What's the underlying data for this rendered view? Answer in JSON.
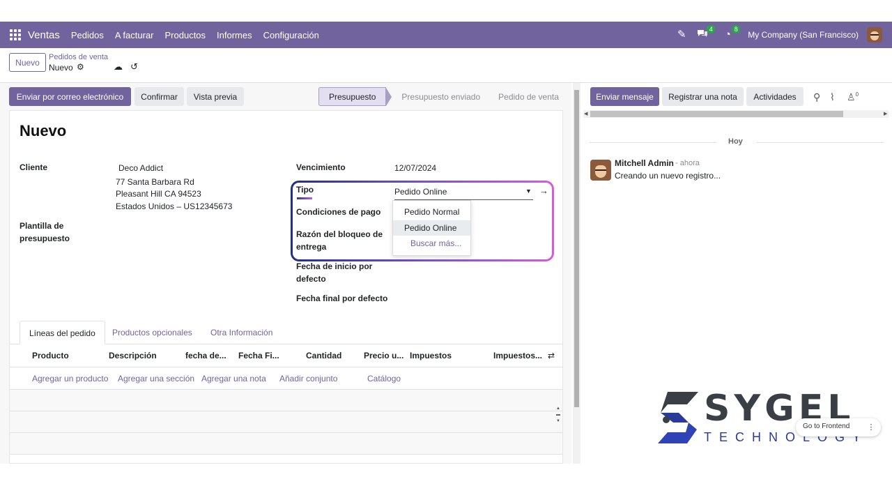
{
  "nav": {
    "app": "Ventas",
    "menu": [
      "Pedidos",
      "A facturar",
      "Productos",
      "Informes",
      "Configuración"
    ],
    "messages_count": "4",
    "activities_count": "8",
    "company": "My Company (San Francisco)"
  },
  "control": {
    "new_label": "Nuevo",
    "breadcrumb": "Pedidos de venta",
    "record": "Nuevo"
  },
  "actions": {
    "email": "Enviar por correo electrónico",
    "confirm": "Confirmar",
    "preview": "Vista previa"
  },
  "status": [
    "Presupuesto",
    "Presupuesto enviado",
    "Pedido de venta"
  ],
  "form": {
    "title": "Nuevo",
    "cliente_label": "Cliente",
    "cliente_name": "Deco Addict",
    "cliente_addr1": "77 Santa Barbara Rd",
    "cliente_addr2": "Pleasant Hill CA 94523",
    "cliente_addr3": "Estados Unidos – US12345673",
    "plantilla_label1": "Plantilla de",
    "plantilla_label2": "presupuesto",
    "vencimiento_label": "Vencimiento",
    "vencimiento_value": "12/07/2024",
    "tipo_label": "Tipo",
    "tipo_value": "Pedido Online",
    "condiciones_label": "Condiciones de pago",
    "razon_label1": "Razón del bloqueo de",
    "razon_label2": "entrega",
    "fecha_inicio_label1": "Fecha de inicio por",
    "fecha_inicio_label2": "defecto",
    "fecha_final_label": "Fecha final por defecto"
  },
  "dropdown": {
    "options": [
      "Pedido Normal",
      "Pedido Online"
    ],
    "more": "Buscar más..."
  },
  "tabs": [
    "Líneas del pedido",
    "Productos opcionales",
    "Otra Información"
  ],
  "table": {
    "headers": [
      "Producto",
      "Descripción",
      "fecha de...",
      "Fecha Fi...",
      "Cantidad",
      "Precio u...",
      "Impuestos",
      "Impuestos..."
    ],
    "actions": [
      "Agregar un producto",
      "Agregar una sección",
      "Agregar una nota",
      "Añadir conjunto",
      "Catálogo"
    ]
  },
  "chatter": {
    "send": "Enviar mensaje",
    "note": "Registrar una nota",
    "activities": "Actividades",
    "followers": "0",
    "day": "Hoy",
    "author": "Mitchell Admin",
    "time": "- ahora",
    "body": "Creando un nuevo registro..."
  },
  "watermark": {
    "brand": "SYGEL",
    "sub": "TECHNOLOGY",
    "frontend": "Go to Frontend"
  },
  "colors": {
    "brand": "#71639e",
    "badge": "#28a745",
    "logo_dark": "#3a3f45",
    "logo_blue": "#2a3a9a"
  }
}
